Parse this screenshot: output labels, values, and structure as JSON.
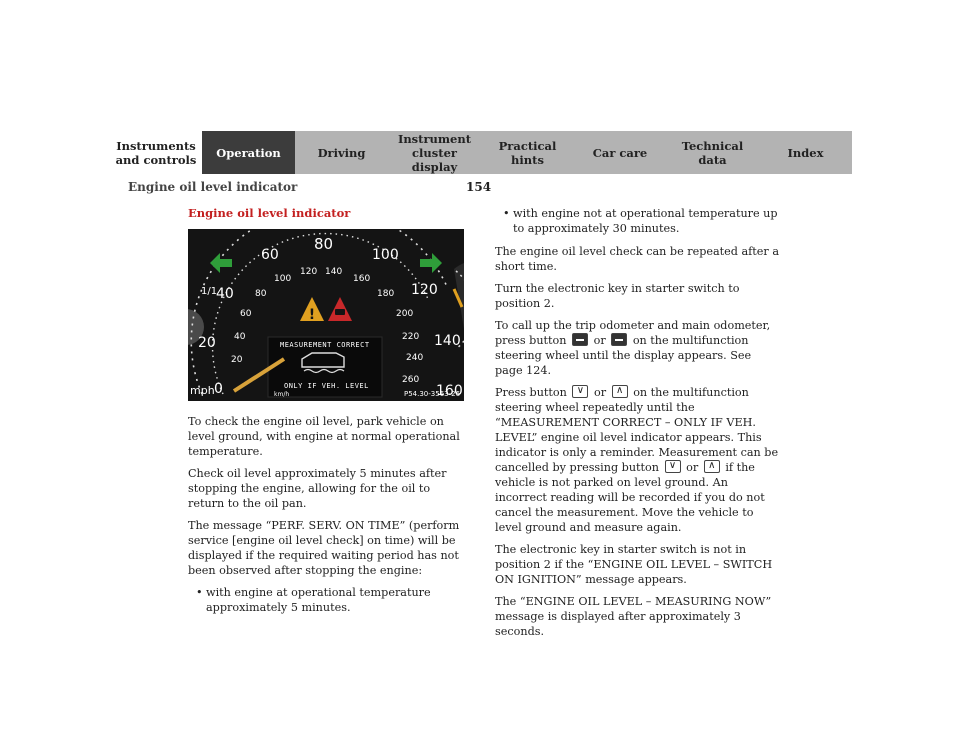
{
  "nav": {
    "tabs": [
      {
        "label": "Instruments\nand controls",
        "style": "light"
      },
      {
        "label": "Operation",
        "style": "active"
      },
      {
        "label": "Driving",
        "style": "mid"
      },
      {
        "label": "Instrument\ncluster display",
        "style": "mid"
      },
      {
        "label": "Practical hints",
        "style": "mid"
      },
      {
        "label": "Car care",
        "style": "mid"
      },
      {
        "label": "Technical\ndata",
        "style": "mid"
      },
      {
        "label": "Index",
        "style": "mid"
      }
    ]
  },
  "header": {
    "running_title": "Engine oil level indicator",
    "page_number": "154"
  },
  "section": {
    "heading": "Engine oil level indicator"
  },
  "figure": {
    "speed_mph": [
      "20",
      "40",
      "60",
      "80",
      "100",
      "120",
      "140",
      "160"
    ],
    "speed_kmh": [
      "20",
      "40",
      "60",
      "80",
      "100",
      "120",
      "140",
      "160",
      "180",
      "200",
      "220",
      "240",
      "260"
    ],
    "zero_label": "0",
    "mph_unit": "mph",
    "kmh_unit": "km/h",
    "fuel_fraction": "1/1",
    "display_top": "MEASUREMENT CORRECT",
    "display_bottom": "ONLY IF VEH. LEVEL",
    "figure_code": "P54.30-3563-26",
    "colors": {
      "arrow_green": "#2f9e3a",
      "warning_amber": "#e0a020",
      "warning_red": "#c8282a",
      "needle": "#d8a23a"
    }
  },
  "left": {
    "p1": "To check the engine oil level, park vehicle on level ground, with engine at normal operational temperature.",
    "p2": "Check oil level approximately 5 minutes after stopping the engine, allowing for the oil to return to the oil pan.",
    "p3": "The message “PERF. SERV. ON TIME” (perform service [engine oil level check] on time) will be displayed if the required waiting period has not been observed after stopping the engine:",
    "bullet1": "with engine at operational temperature approximately 5 minutes."
  },
  "right": {
    "bullet2": "with engine not at operational temperature up to approximately 30 minutes.",
    "p1": "The engine oil level check can be repeated after a short time.",
    "p2": "Turn the electronic key in starter switch to position 2.",
    "p3_a": "To call up the trip odometer and main odometer, press button",
    "p3_or": "or",
    "p3_b": "on the multifunction steering wheel until the display appears. See page 124.",
    "p4_a": "Press button",
    "p4_or": "or",
    "p4_b": "on the multifunction steering wheel repeatedly until the “MEASUREMENT CORRECT – ONLY IF VEH. LEVEL” engine oil level indicator appears. This indicator is only a reminder. Measurement can be cancelled by pressing button",
    "p4_or2": "or",
    "p4_c": "if the vehicle is not parked on level ground. An incorrect reading will be recorded if you do not cancel the measurement. Move the vehicle to level ground and measure again.",
    "p5": "The electronic key in starter switch is not in position 2 if the “ENGINE OIL LEVEL – SWITCH ON IGNITION” message appears.",
    "p6": "The “ENGINE OIL LEVEL – MEASURING NOW” message is displayed after approximately 3 seconds."
  }
}
